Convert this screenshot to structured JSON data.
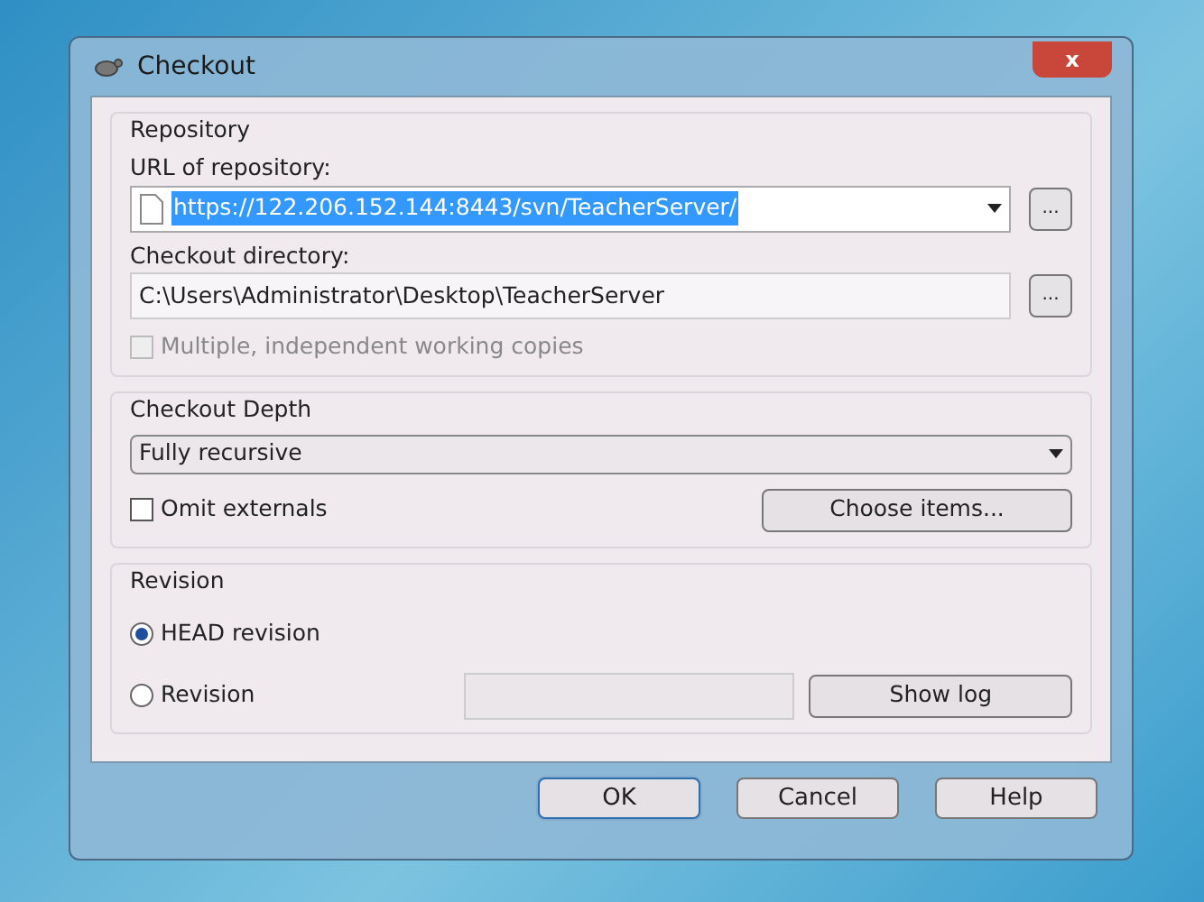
{
  "window": {
    "title": "Checkout",
    "close_label": "x"
  },
  "repository": {
    "title": "Repository",
    "url_label": "URL of repository:",
    "url_value": "https://122.206.152.144:8443/svn/TeacherServer/",
    "url_selected": true,
    "url_browse": "...",
    "directory_label": "Checkout directory:",
    "directory_value": "C:\\Users\\Administrator\\Desktop\\TeacherServer",
    "directory_browse": "...",
    "multiple_copies": {
      "label": "Multiple, independent working copies",
      "checked": false,
      "disabled": true
    }
  },
  "depth": {
    "title": "Checkout Depth",
    "value": "Fully recursive",
    "omit_externals": {
      "label": "Omit externals",
      "checked": false,
      "disabled": false
    },
    "choose_button": "Choose items..."
  },
  "revision": {
    "title": "Revision",
    "options": [
      {
        "label": "HEAD revision",
        "selected": true
      },
      {
        "label": "Revision",
        "selected": false
      }
    ],
    "show_log_button": "Show log"
  },
  "buttons": [
    {
      "label": "OK",
      "default": true
    },
    {
      "label": "Cancel",
      "default": false
    },
    {
      "label": "Help",
      "default": false
    }
  ]
}
